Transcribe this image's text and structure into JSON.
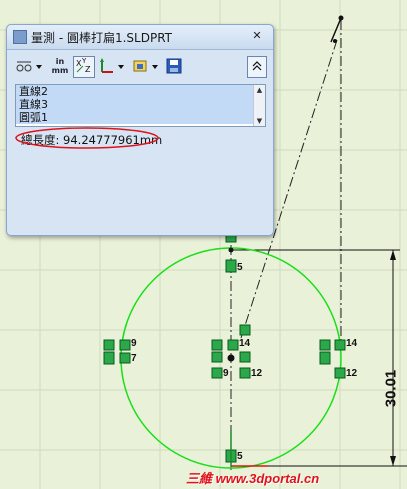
{
  "window": {
    "title": "量測 - 圓棒打扁1.SLDPRT",
    "close_glyph": "✕",
    "toolbar": {
      "units_label_top": "in",
      "units_label_bottom": "mm"
    },
    "selection_list": [
      "直線2",
      "直線3",
      "圓弧1"
    ],
    "result_text": "總長度: 94.24777961mm"
  },
  "sketch": {
    "dimension_value": "30.01",
    "relation_labels": [
      "5",
      "9",
      "7",
      "14",
      "9",
      "12",
      "14",
      "12",
      "5"
    ]
  },
  "watermark": {
    "prefix": "三維",
    "site": "www.3dportal.cn"
  },
  "colors": {
    "background": "#e9f1d9",
    "sketch_green": "#18e018",
    "highlight_red": "#e0121a"
  }
}
